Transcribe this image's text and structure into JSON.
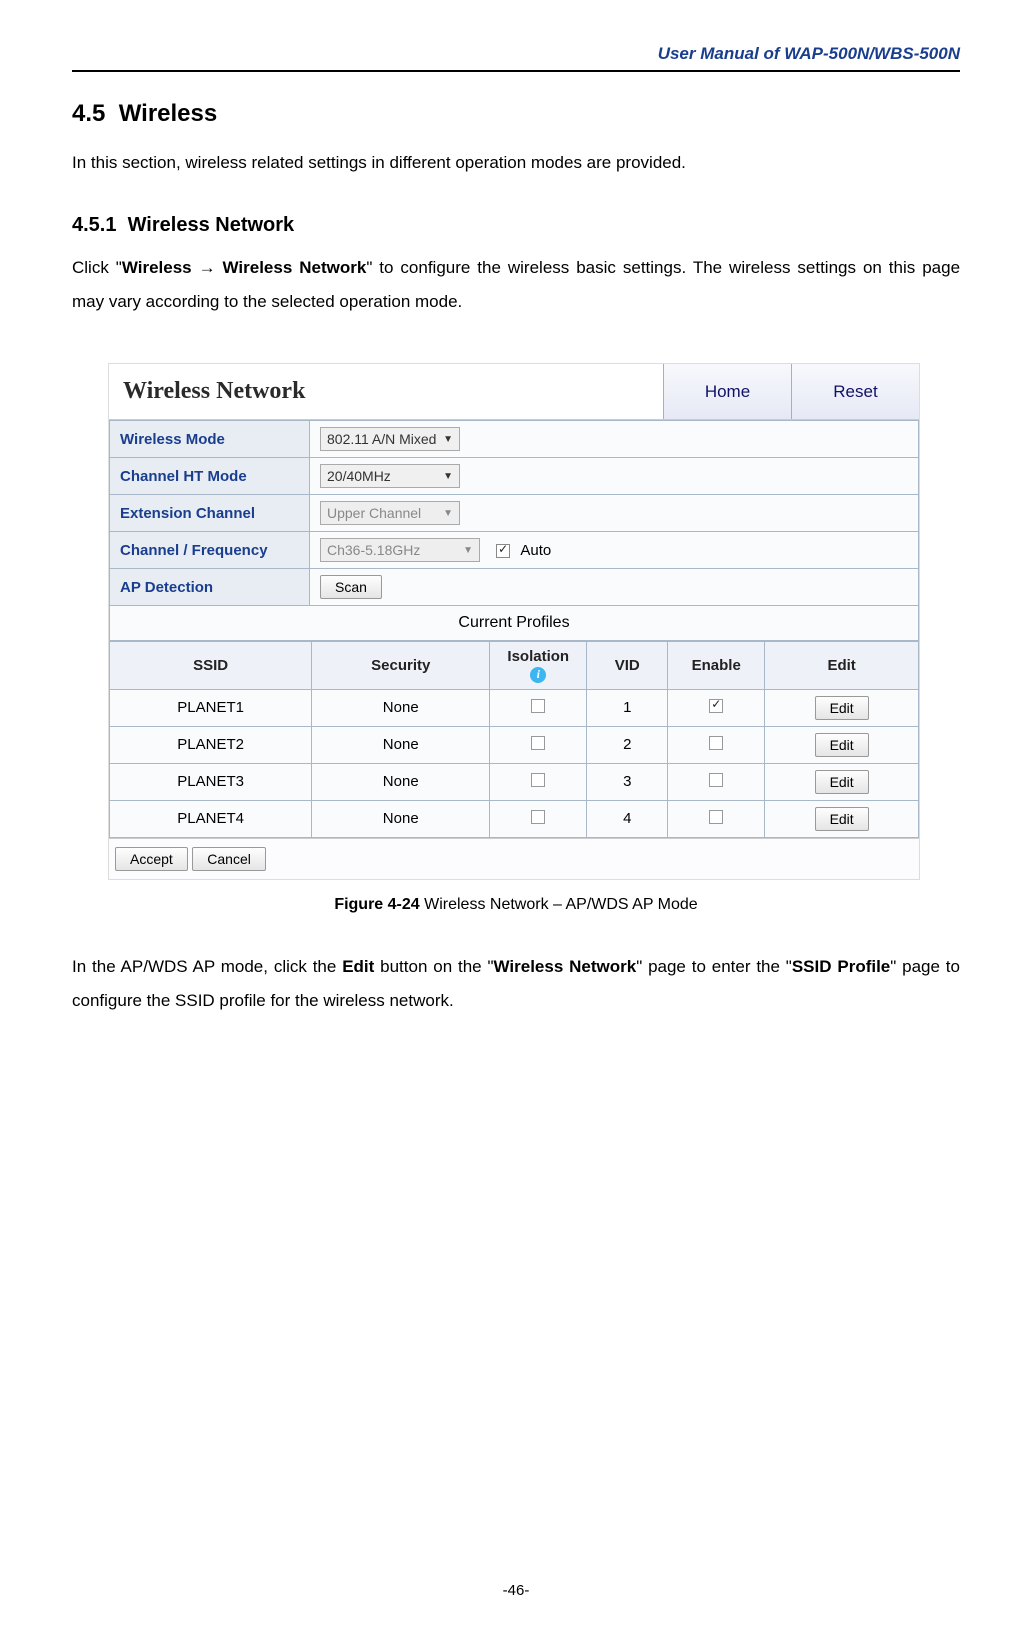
{
  "doc_header": "User  Manual  of  WAP-500N/WBS-500N",
  "section_number": "4.5",
  "section_title": "Wireless",
  "section_intro": "In this section, wireless related settings in different operation modes are provided.",
  "sub_number": "4.5.1",
  "sub_title": "Wireless Network",
  "sub_body_1a": "Click \"",
  "sub_body_1b": "Wireless ",
  "sub_body_1c": " Wireless Network",
  "sub_body_1d": "\" to configure the wireless basic settings. The wireless settings on this page may vary according to the selected operation mode.",
  "arrow": "→",
  "panel": {
    "title": "Wireless Network",
    "home": "Home",
    "reset": "Reset",
    "rows": {
      "wireless_mode": {
        "label": "Wireless Mode",
        "value": "802.11 A/N Mixed"
      },
      "channel_ht": {
        "label": "Channel HT Mode",
        "value": "20/40MHz"
      },
      "ext_channel": {
        "label": "Extension Channel",
        "value": "Upper Channel"
      },
      "channel_freq": {
        "label": "Channel / Frequency",
        "value": "Ch36-5.18GHz",
        "auto_label": "Auto"
      },
      "ap_detection": {
        "label": "AP Detection",
        "btn": "Scan"
      }
    },
    "profiles_header": "Current Profiles",
    "profile_cols": {
      "ssid": "SSID",
      "security": "Security",
      "isolation": "Isolation",
      "vid": "VID",
      "enable": "Enable",
      "edit": "Edit"
    },
    "profiles": [
      {
        "ssid": "PLANET1",
        "security": "None",
        "isolation": false,
        "vid": "1",
        "enable": true,
        "edit": "Edit"
      },
      {
        "ssid": "PLANET2",
        "security": "None",
        "isolation": false,
        "vid": "2",
        "enable": false,
        "edit": "Edit"
      },
      {
        "ssid": "PLANET3",
        "security": "None",
        "isolation": false,
        "vid": "3",
        "enable": false,
        "edit": "Edit"
      },
      {
        "ssid": "PLANET4",
        "security": "None",
        "isolation": false,
        "vid": "4",
        "enable": false,
        "edit": "Edit"
      }
    ],
    "accept": "Accept",
    "cancel": "Cancel"
  },
  "figure_bold": "Figure 4-24",
  "figure_rest": " Wireless Network – AP/WDS AP Mode",
  "para2_a": "In the AP/WDS AP mode, click the ",
  "para2_b": "Edit",
  "para2_c": " button on the \"",
  "para2_d": "Wireless Network",
  "para2_e": "\" page to enter the \"",
  "para2_f": "SSID Profile",
  "para2_g": "\" page to configure the SSID profile for the wireless network.",
  "page_number": "-46-",
  "info_glyph": "i"
}
